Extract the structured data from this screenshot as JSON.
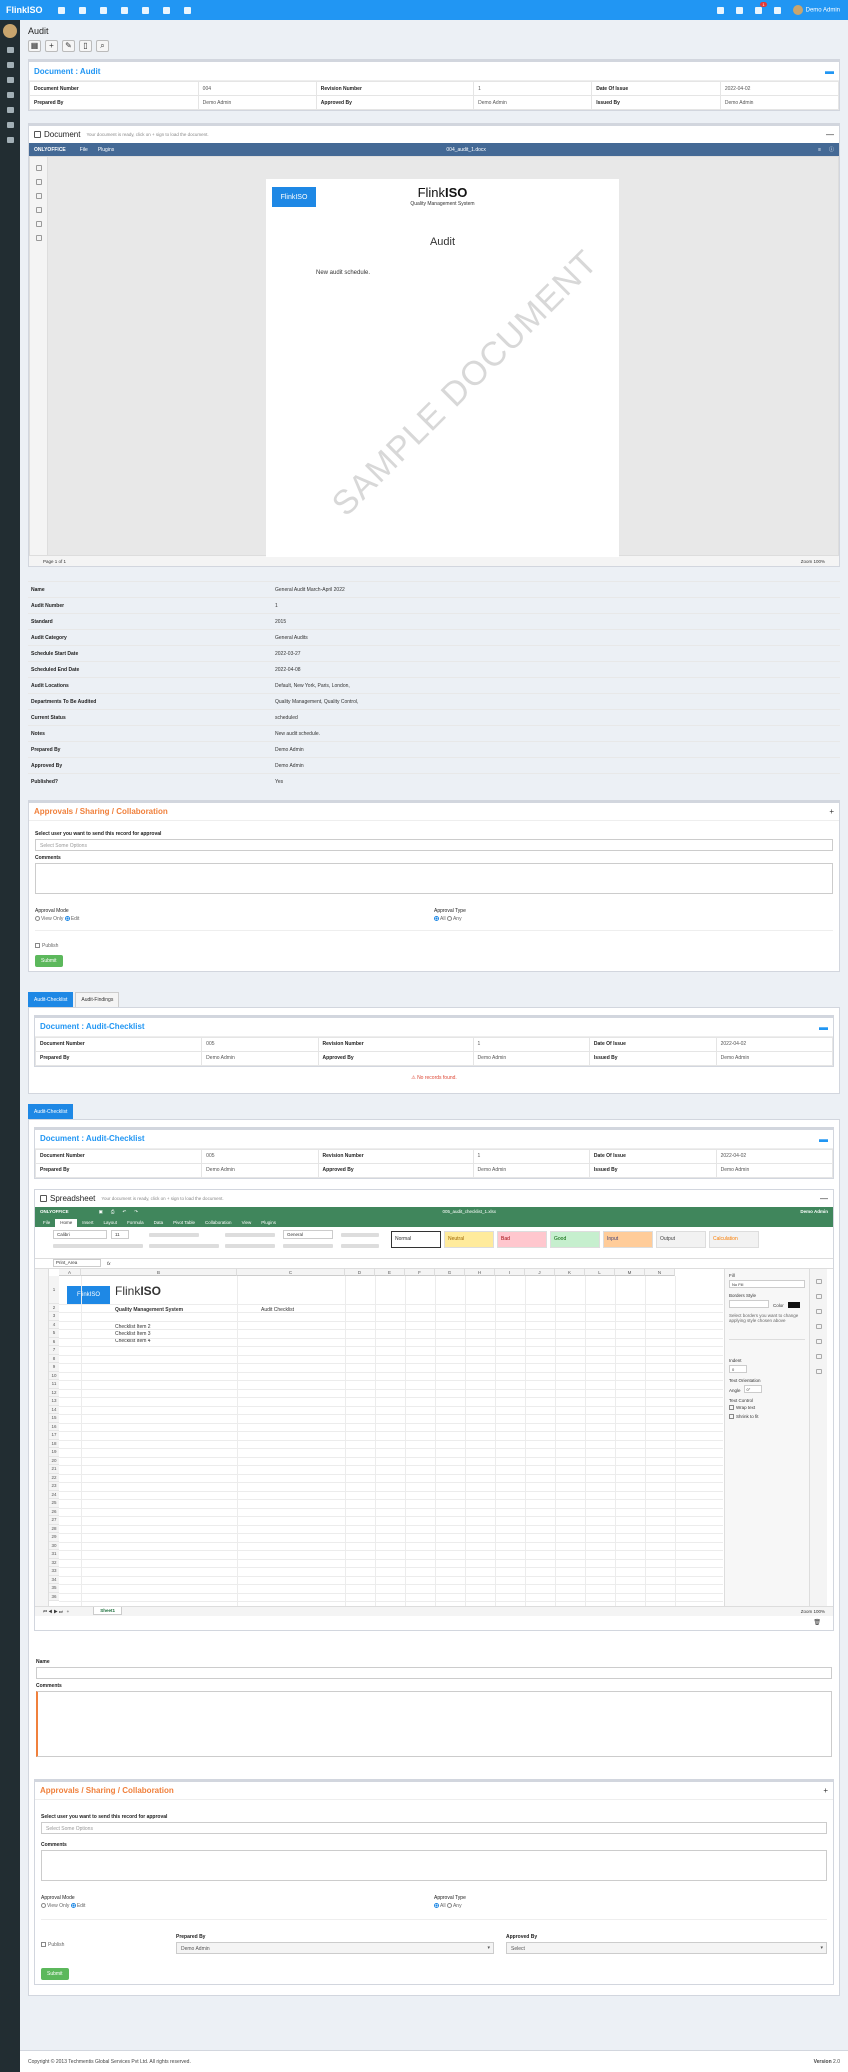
{
  "app": {
    "brand": "FlinkISO",
    "user": "Demo Admin",
    "notification_count": "1"
  },
  "page": {
    "title": "Audit"
  },
  "doc_header": {
    "title": "Document : Audit",
    "row1": [
      {
        "l": "Document Number",
        "v": "004"
      },
      {
        "l": "Revision Number",
        "v": "1"
      },
      {
        "l": "Date Of Issue",
        "v": "2022-04-02"
      }
    ],
    "row2": [
      {
        "l": "Prepared By",
        "v": "Demo Admin"
      },
      {
        "l": "Approved By",
        "v": "Demo Admin"
      },
      {
        "l": "Issued By",
        "v": "Demo Admin"
      }
    ]
  },
  "document": {
    "title": "Document",
    "hint": "Your document is ready, click on + sign to load the document.",
    "editor": "ONLYOFFICE",
    "menu": [
      "File",
      "Plugins"
    ],
    "filename": "004_audit_1.docx",
    "page_logo": "FlinkISO",
    "page_title_a": "Flink",
    "page_title_b": "ISO",
    "page_subtitle": "Quality Management System",
    "heading": "Audit",
    "body": "New audit schedule.",
    "watermark": "SAMPLE DOCUMENT",
    "status_left": "Page 1 of 1",
    "zoom": "Zoom 100%"
  },
  "details": [
    {
      "l": "Name",
      "v": "General Audit March-April 2022"
    },
    {
      "l": "Audit Number",
      "v": "1"
    },
    {
      "l": "Standard",
      "v": "2015"
    },
    {
      "l": "Audit Category",
      "v": "General Audits"
    },
    {
      "l": "Schedule Start Date",
      "v": "2022-03-27"
    },
    {
      "l": "Scheduled End Date",
      "v": "2022-04-08"
    },
    {
      "l": "Audit Locations",
      "v": "Default, New York, Paris, London,"
    },
    {
      "l": "Departments To Be Audited",
      "v": "Quality Management, Quality Control,"
    },
    {
      "l": "Current Status",
      "v": "scheduled"
    },
    {
      "l": "Notes",
      "v": "New audit schedule."
    },
    {
      "l": "Prepared By",
      "v": "Demo Admin"
    },
    {
      "l": "Approved By",
      "v": "Demo Admin"
    },
    {
      "l": "Published?",
      "v": "Yes"
    }
  ],
  "approvals": {
    "title": "Approvals / Sharing / Collaboration",
    "select_label": "Select user you want to send this record for approval",
    "select_placeholder": "Select Some Options",
    "comments": "Comments",
    "mode_label": "Approval Mode",
    "mode_opts": [
      "View Only",
      "Edit"
    ],
    "type_label": "Approval Type",
    "type_opts": [
      "All",
      "Any"
    ],
    "publish": "Publish",
    "submit": "Submit"
  },
  "tabs": [
    "Audit-Checklist",
    "Audit-Findings"
  ],
  "checklist": {
    "title": "Document : Audit-Checklist",
    "row1": [
      {
        "l": "Document Number",
        "v": "005"
      },
      {
        "l": "Revision Number",
        "v": "1"
      },
      {
        "l": "Date Of Issue",
        "v": "2022-04-02"
      }
    ],
    "row2": [
      {
        "l": "Prepared By",
        "v": "Demo Admin"
      },
      {
        "l": "Approved By",
        "v": "Demo Admin"
      },
      {
        "l": "Issued By",
        "v": "Demo Admin"
      }
    ],
    "no_records": "No records found."
  },
  "tab2": "Audit-Checklist",
  "spreadsheet": {
    "title": "Spreadsheet",
    "hint": "Your document is ready, click on + sign to load the document.",
    "editor": "ONLYOFFICE",
    "filename": "005_audit_checklist_1.xlsx",
    "user": "Demo Admin",
    "menu": [
      "File",
      "Home",
      "Insert",
      "Layout",
      "Formula",
      "Data",
      "Pivot Table",
      "Collaboration",
      "View",
      "Plugins"
    ],
    "font": "Calibri",
    "font_size": "11",
    "number_format": "General",
    "styles": [
      {
        "n": "Normal",
        "c": "#ffffff",
        "t": "#333333"
      },
      {
        "n": "Neutral",
        "c": "#ffeb9c",
        "t": "#9c6500"
      },
      {
        "n": "Bad",
        "c": "#ffc7ce",
        "t": "#9c0006"
      },
      {
        "n": "Good",
        "c": "#c6efce",
        "t": "#006100"
      },
      {
        "n": "Input",
        "c": "#ffcc99",
        "t": "#3f3f76"
      },
      {
        "n": "Output",
        "c": "#f2f2f2",
        "t": "#3f3f3f"
      },
      {
        "n": "Calculation",
        "c": "#f2f2f2",
        "t": "#fa7d00"
      }
    ],
    "name_box": "Print_Area",
    "fx": "fx",
    "columns": [
      "A",
      "B",
      "C",
      "D",
      "E",
      "F",
      "G",
      "H",
      "I",
      "J",
      "K",
      "L",
      "M",
      "N"
    ],
    "logo": "FlinkISO",
    "title_a": "Flink",
    "title_b": "ISO",
    "qms": "Quality Management System",
    "checklist_head": "Audit Checklist",
    "items": [
      "Checklist Item 2",
      "Checklist Item 3",
      "Checklist Item 4"
    ],
    "panel": {
      "fill": "Fill",
      "fill_val": "No Fill",
      "borders": "Borders Style",
      "color": "Color",
      "hint": "Select borders you want to change applying style chosen above",
      "indent": "Indent",
      "indent_val": "0",
      "orient": "Text Orientation",
      "angle": "Angle",
      "angle_val": "0°",
      "control": "Text Control",
      "wrap": "Wrap text",
      "shrink": "Shrink to fit"
    },
    "sheet": "Sheet1",
    "zoom": "Zoom 100%"
  },
  "form": {
    "name": "Name",
    "comments": "Comments"
  },
  "approvals2": {
    "title": "Approvals / Sharing / Collaboration",
    "select_label": "Select user you want to send this record for approval",
    "select_placeholder": "Select Some Options",
    "comments": "Comments",
    "mode_label": "Approval Mode",
    "mode_opts": [
      "View Only",
      "Edit"
    ],
    "type_label": "Approval Type",
    "type_opts": [
      "All",
      "Any"
    ],
    "publish": "Publish",
    "prepared": "Prepared By",
    "prepared_val": "Demo Admin",
    "approved": "Approved By",
    "approved_val": "Select",
    "submit": "Submit"
  },
  "footer": {
    "copy": "Copyright © 2013 Techmentis Global Services Pvt Ltd. All rights reserved.",
    "version_label": "Version",
    "version": "2.0"
  }
}
